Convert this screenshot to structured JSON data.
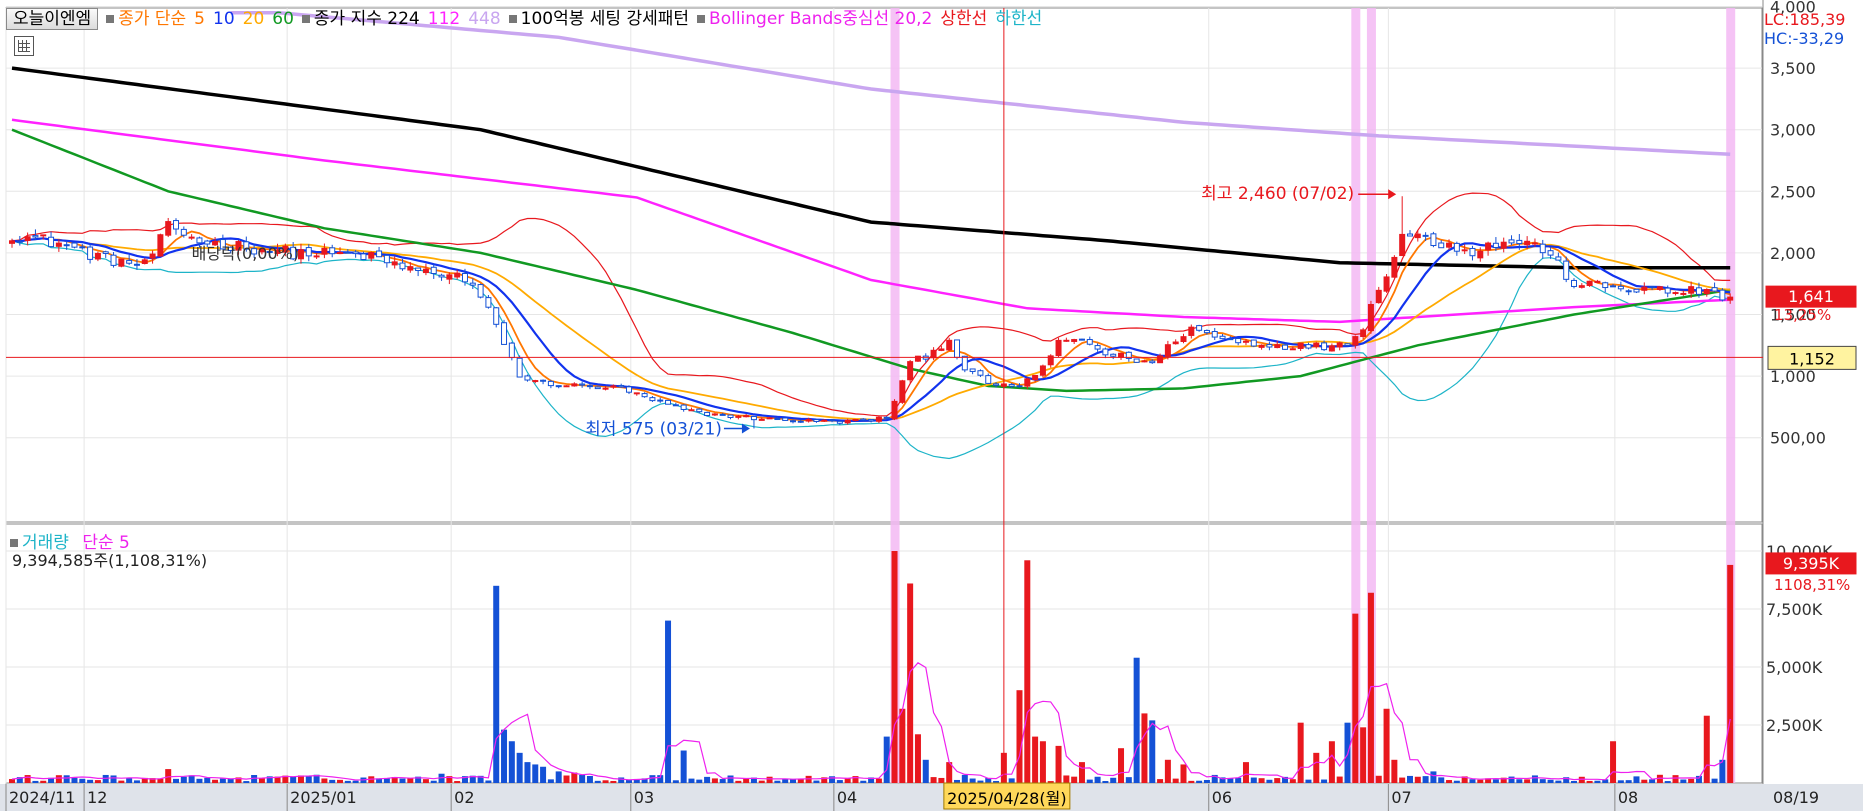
{
  "header": {
    "stock_name": "오늘이엔엠",
    "ma_label": "종가 단순",
    "ma_periods": [
      "5",
      "10",
      "20",
      "60"
    ],
    "ma_colors": [
      "#ff7700",
      "#1133ee",
      "#ffaa00",
      "#119922"
    ],
    "index_label": "종가 지수 224",
    "index_periods": [
      "112",
      "448"
    ],
    "index_colors": [
      "#ff22ff",
      "#c9a6f0"
    ],
    "pattern_label": "100억봉 세팅 강세패턴",
    "bollinger_label": "Bollinger Bands중심선 20,2",
    "upper_label": "상한선",
    "lower_label": "하한선"
  },
  "right_info": {
    "lc": "LC:185,39",
    "hc": "HC:-33,29"
  },
  "price_tags": {
    "current": "1,641",
    "change": "13,25%",
    "ref": "1,152"
  },
  "annotations": {
    "high_label": "최고 2,460 (07/02)",
    "low_label": "최저 575 (03/21)",
    "dividend_label": "배당락(0,00%)",
    "crosshair_date": "2025/04/28(월)"
  },
  "volume_panel": {
    "title": "거래량",
    "ma_label": "단순 5",
    "info": "9,394,585주(1,108,31%)",
    "current_tag": "9,395K",
    "current_pct": "1108,31%"
  },
  "colors": {
    "up": "#e8181e",
    "down": "#1451d6",
    "bb_upper": "#e8181e",
    "bb_lower": "#1db4c8",
    "highlight": "#f3b8f3"
  },
  "chart_data": {
    "type": "candlestick",
    "x_labels": [
      {
        "label": "2024/11",
        "idx": 0
      },
      {
        "label": "12",
        "idx": 10
      },
      {
        "label": "2025/01",
        "idx": 36
      },
      {
        "label": "02",
        "idx": 57
      },
      {
        "label": "03",
        "idx": 80
      },
      {
        "label": "04",
        "idx": 106
      },
      {
        "label": "06",
        "idx": 154
      },
      {
        "label": "07",
        "idx": 177
      },
      {
        "label": "08",
        "idx": 206
      },
      {
        "label": "08/19",
        "idx": 226
      }
    ],
    "price_axis": {
      "min": 0,
      "max": 4000,
      "ticks": [
        "4,000",
        "3,500",
        "3,000",
        "2,500",
        "2,000",
        "1,500",
        "1,000",
        "500,00"
      ],
      "tick_values": [
        4000,
        3500,
        3000,
        2500,
        2000,
        1500,
        1000,
        500
      ]
    },
    "volume_axis": {
      "max": 10000000,
      "ticks": [
        "10,000K",
        "7,500K",
        "5,000K",
        "2,500K"
      ],
      "tick_values": [
        10000000,
        7500000,
        5000000,
        2500000
      ]
    },
    "price_keyframes": [
      [
        0,
        2150
      ],
      [
        6,
        2080
      ],
      [
        12,
        1950
      ],
      [
        17,
        1900
      ],
      [
        20,
        2200
      ],
      [
        25,
        2080
      ],
      [
        30,
        2050
      ],
      [
        36,
        2000
      ],
      [
        45,
        1980
      ],
      [
        52,
        1850
      ],
      [
        57,
        1820
      ],
      [
        60,
        1650
      ],
      [
        63,
        1280
      ],
      [
        65,
        1000
      ],
      [
        67,
        950
      ],
      [
        72,
        920
      ],
      [
        78,
        900
      ],
      [
        82,
        800
      ],
      [
        88,
        700
      ],
      [
        95,
        660
      ],
      [
        100,
        640
      ],
      [
        106,
        630
      ],
      [
        109,
        640
      ],
      [
        112,
        660
      ],
      [
        115,
        1100
      ],
      [
        118,
        1200
      ],
      [
        120,
        1300
      ],
      [
        122,
        1050
      ],
      [
        125,
        950
      ],
      [
        128,
        900
      ],
      [
        131,
        1000
      ],
      [
        134,
        1260
      ],
      [
        137,
        1300
      ],
      [
        140,
        1180
      ],
      [
        143,
        1150
      ],
      [
        146,
        1100
      ],
      [
        149,
        1300
      ],
      [
        151,
        1390
      ],
      [
        154,
        1320
      ],
      [
        157,
        1280
      ],
      [
        162,
        1250
      ],
      [
        168,
        1240
      ],
      [
        171,
        1280
      ],
      [
        173,
        1400
      ],
      [
        175,
        1720
      ],
      [
        177,
        1980
      ],
      [
        179,
        2150
      ],
      [
        182,
        2100
      ],
      [
        187,
        2020
      ],
      [
        192,
        2100
      ],
      [
        196,
        2040
      ],
      [
        200,
        1750
      ],
      [
        205,
        1720
      ],
      [
        210,
        1700
      ],
      [
        214,
        1680
      ],
      [
        217,
        1700
      ],
      [
        219,
        1600
      ],
      [
        220,
        1641
      ]
    ],
    "low_point": {
      "idx": 95,
      "price": 575
    },
    "high_point": {
      "idx": 178,
      "price": 2460
    },
    "ma224_keyframes": [
      [
        0,
        3080
      ],
      [
        40,
        2750
      ],
      [
        80,
        2450
      ],
      [
        110,
        1780
      ],
      [
        130,
        1550
      ],
      [
        150,
        1480
      ],
      [
        170,
        1440
      ],
      [
        200,
        1560
      ],
      [
        220,
        1620
      ]
    ],
    "ma448_keyframes": [
      [
        0,
        3500
      ],
      [
        30,
        3250
      ],
      [
        60,
        3000
      ],
      [
        90,
        2550
      ],
      [
        110,
        2250
      ],
      [
        140,
        2100
      ],
      [
        170,
        1920
      ],
      [
        200,
        1880
      ],
      [
        220,
        1880
      ]
    ],
    "ma112_keyframes": [
      [
        34,
        3950
      ],
      [
        70,
        3750
      ],
      [
        110,
        3330
      ],
      [
        150,
        3060
      ],
      [
        175,
        2950
      ],
      [
        220,
        2800
      ]
    ],
    "ma60_keyframes": [
      [
        0,
        3000
      ],
      [
        20,
        2500
      ],
      [
        40,
        2200
      ],
      [
        60,
        2000
      ],
      [
        80,
        1700
      ],
      [
        100,
        1350
      ],
      [
        115,
        1060
      ],
      [
        125,
        920
      ],
      [
        135,
        880
      ],
      [
        150,
        900
      ],
      [
        165,
        1000
      ],
      [
        180,
        1250
      ],
      [
        200,
        1500
      ],
      [
        220,
        1700
      ]
    ],
    "volumes": [
      {
        "i": 20,
        "v": 600000
      },
      {
        "i": 55,
        "v": 400000
      },
      {
        "i": 62,
        "v": 8500000
      },
      {
        "i": 63,
        "v": 2300000
      },
      {
        "i": 64,
        "v": 1800000
      },
      {
        "i": 65,
        "v": 1300000
      },
      {
        "i": 66,
        "v": 900000
      },
      {
        "i": 67,
        "v": 800000
      },
      {
        "i": 68,
        "v": 700000
      },
      {
        "i": 70,
        "v": 500000
      },
      {
        "i": 72,
        "v": 450000
      },
      {
        "i": 84,
        "v": 7000000
      },
      {
        "i": 86,
        "v": 1400000
      },
      {
        "i": 112,
        "v": 2000000
      },
      {
        "i": 113,
        "v": 10000000
      },
      {
        "i": 114,
        "v": 3200000
      },
      {
        "i": 115,
        "v": 8600000
      },
      {
        "i": 116,
        "v": 2100000
      },
      {
        "i": 117,
        "v": 1000000
      },
      {
        "i": 120,
        "v": 900000
      },
      {
        "i": 127,
        "v": 1300000
      },
      {
        "i": 129,
        "v": 4000000
      },
      {
        "i": 130,
        "v": 9600000
      },
      {
        "i": 131,
        "v": 2000000
      },
      {
        "i": 132,
        "v": 1800000
      },
      {
        "i": 134,
        "v": 1600000
      },
      {
        "i": 137,
        "v": 900000
      },
      {
        "i": 142,
        "v": 1500000
      },
      {
        "i": 144,
        "v": 5400000
      },
      {
        "i": 145,
        "v": 3000000
      },
      {
        "i": 146,
        "v": 2700000
      },
      {
        "i": 148,
        "v": 1000000
      },
      {
        "i": 150,
        "v": 800000
      },
      {
        "i": 158,
        "v": 900000
      },
      {
        "i": 165,
        "v": 2600000
      },
      {
        "i": 167,
        "v": 1300000
      },
      {
        "i": 169,
        "v": 1800000
      },
      {
        "i": 171,
        "v": 2600000
      },
      {
        "i": 172,
        "v": 7300000
      },
      {
        "i": 173,
        "v": 2400000
      },
      {
        "i": 174,
        "v": 8200000
      },
      {
        "i": 176,
        "v": 3200000
      },
      {
        "i": 177,
        "v": 1000000
      },
      {
        "i": 182,
        "v": 500000
      },
      {
        "i": 205,
        "v": 1800000
      },
      {
        "i": 217,
        "v": 2900000
      },
      {
        "i": 219,
        "v": 1000000
      },
      {
        "i": 220,
        "v": 9400000
      }
    ],
    "highlight_idx": [
      113,
      172,
      174,
      220
    ],
    "crosshair": {
      "idx": 127,
      "price": 1152
    }
  }
}
